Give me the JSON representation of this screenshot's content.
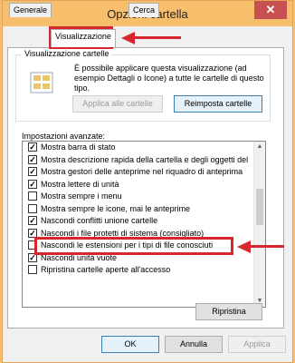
{
  "window": {
    "title": "Opzioni cartella",
    "close_glyph": "✕"
  },
  "tabs": [
    "Generale",
    "Visualizzazione",
    "Cerca"
  ],
  "folder_views": {
    "group_label": "Visualizzazione cartelle",
    "description": "È possibile applicare questa visualizzazione (ad esempio Dettagli o Icone) a tutte le cartelle di questo tipo.",
    "apply_button": "Applica alle cartelle",
    "reset_button": "Reimposta cartelle"
  },
  "advanced": {
    "label": "Impostazioni avanzate:",
    "items": [
      {
        "label": "Mostra barra di stato",
        "checked": true
      },
      {
        "label": "Mostra descrizione rapida della cartella e degli oggetti del",
        "checked": true
      },
      {
        "label": "Mostra gestori delle anteprime nel riquadro di anteprima",
        "checked": true
      },
      {
        "label": "Mostra lettere di unità",
        "checked": true
      },
      {
        "label": "Mostra sempre i menu",
        "checked": false
      },
      {
        "label": "Mostra sempre le icone, mai le anteprime",
        "checked": false
      },
      {
        "label": "Nascondi conflitti unione cartelle",
        "checked": true
      },
      {
        "label": "Nascondi i file protetti di sistema (consigliato)",
        "checked": true
      },
      {
        "label": "Nascondi le estensioni per i tipi di file conosciuti",
        "checked": false
      },
      {
        "label": "Nascondi unità vuote",
        "checked": true
      },
      {
        "label": "Ripristina cartelle aperte all'accesso",
        "checked": false
      }
    ],
    "restore_button": "Ripristina"
  },
  "footer": {
    "ok": "OK",
    "cancel": "Annulla",
    "apply": "Applica"
  },
  "colors": {
    "highlight": "#d7262d",
    "titlebar": "#f7bf6c",
    "close": "#c75050"
  }
}
